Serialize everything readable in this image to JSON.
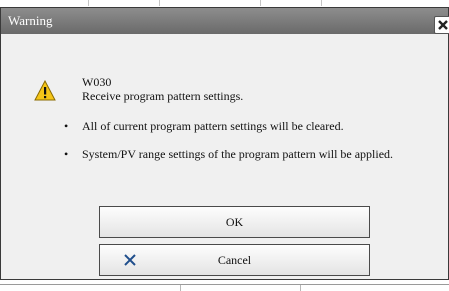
{
  "dialog": {
    "title": "Warning",
    "close_icon": "close-icon",
    "warning_icon": "warning-triangle-icon",
    "code": "W030",
    "message": "Receive program pattern settings.",
    "bullets": [
      "All of current program pattern settings will be cleared.",
      "System/PV range settings of the program pattern will be applied."
    ],
    "ok_label": "OK",
    "cancel_label": "Cancel",
    "cancel_icon": "x-cancel-icon"
  },
  "colors": {
    "titlebar": "#7a7a7a",
    "title_text": "#ffffff",
    "dialog_bg": "#f0f0f0",
    "warning_yellow": "#f5c518",
    "cancel_x_blue": "#1f4e8c"
  }
}
